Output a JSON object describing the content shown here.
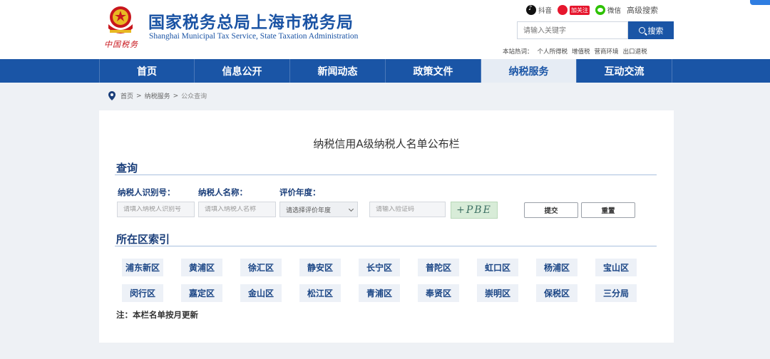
{
  "header": {
    "site_title": "国家税务总局上海市税务局",
    "site_subtitle": "Shanghai Municipal Tax Service, State Taxation Administration",
    "logo_signature": "中国税务",
    "top_links": {
      "douyin": "抖音",
      "weibo": "加关注",
      "wechat": "微信",
      "advanced_search": "高级搜索"
    },
    "search": {
      "placeholder": "请输入关键字",
      "button": "搜索"
    },
    "hot_words": {
      "label": "本站热词：",
      "items": [
        "个人所得税",
        "增值税",
        "营商环境",
        "出口退税"
      ]
    }
  },
  "nav": {
    "items": [
      {
        "label": "首页"
      },
      {
        "label": "信息公开"
      },
      {
        "label": "新闻动态"
      },
      {
        "label": "政策文件"
      },
      {
        "label": "纳税服务",
        "active": true
      },
      {
        "label": "互动交流"
      }
    ]
  },
  "breadcrumb": {
    "items": [
      "首页",
      "纳税服务",
      "公众查询"
    ],
    "separator": ">"
  },
  "main": {
    "title": "纳税信用A级纳税人名单公布栏",
    "query_section": {
      "title": "查询",
      "labels": {
        "taxpayer_id": "纳税人识别号：",
        "taxpayer_name": "纳税人名称：",
        "eval_year": "评价年度："
      },
      "placeholders": {
        "taxpayer_id": "请填入纳税人识别号",
        "taxpayer_name": "请填入纳税人名称",
        "eval_year": "请选择评价年度",
        "captcha": "请输入验证码"
      },
      "captcha_text": "+PBE",
      "submit": "提交",
      "reset": "重置"
    },
    "district_section": {
      "title": "所在区索引",
      "districts": [
        "浦东新区",
        "黄浦区",
        "徐汇区",
        "静安区",
        "长宁区",
        "普陀区",
        "虹口区",
        "杨浦区",
        "宝山区",
        "闵行区",
        "嘉定区",
        "金山区",
        "松江区",
        "青浦区",
        "奉贤区",
        "崇明区",
        "保税区",
        "三分局"
      ]
    },
    "note": "注：本栏名单按月更新"
  },
  "colors": {
    "brand_blue": "#1a55a6",
    "nav_active_bg": "#e6ecf4",
    "page_bg": "#eef1f5"
  }
}
